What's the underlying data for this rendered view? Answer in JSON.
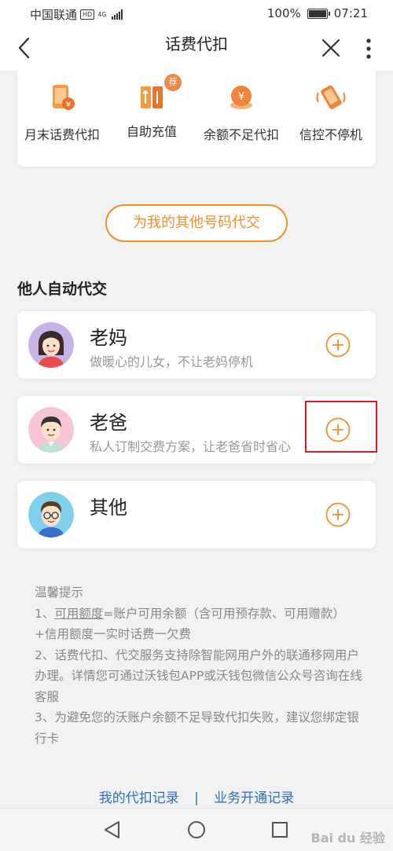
{
  "status_bar": {
    "carrier": "中国联通",
    "hd": "HD",
    "network": "4G",
    "battery": "100%",
    "time": "07:21"
  },
  "nav": {
    "title": "话费代扣"
  },
  "services": [
    {
      "label": "月末话费代扣",
      "icon": "phone-coin-icon"
    },
    {
      "label": "自助充值",
      "icon": "recharge-icon",
      "badge": "荐"
    },
    {
      "label": "余额不足代扣",
      "icon": "yuan-coin-icon"
    },
    {
      "label": "信控不停机",
      "icon": "vibrating-phone-icon"
    }
  ],
  "other_button": "为我的其他号码代交",
  "section_title": "他人自动代交",
  "contacts": [
    {
      "name": "老妈",
      "desc": "做暖心的儿女，不让老妈停机"
    },
    {
      "name": "老爸",
      "desc": "私人订制交费方案，让老爸省时省心"
    },
    {
      "name": "其他",
      "desc": ""
    }
  ],
  "tips": {
    "title": "温馨提示",
    "line1_prefix": "1、",
    "line1_link": "可用额度",
    "line1_rest": "=账户可用余额（含可用预存款、可用赠款）+信用额度一实时话费一欠费",
    "line2": "2、话费代扣、代交服务支持除智能网用户外的联通移网用户办理。详情您可通过沃钱包APP或沃钱包微信公众号咨询在线客服",
    "line3": "3、为避免您的沃账户余额不足导致代扣失败，建议您绑定银行卡"
  },
  "links": {
    "records": "我的代扣记录",
    "separator": "|",
    "business": "业务开通记录"
  },
  "watermark": "Bai du 经验",
  "colors": {
    "accent": "#f0902c",
    "link": "#2c6fc2",
    "highlight": "#d21f26"
  }
}
